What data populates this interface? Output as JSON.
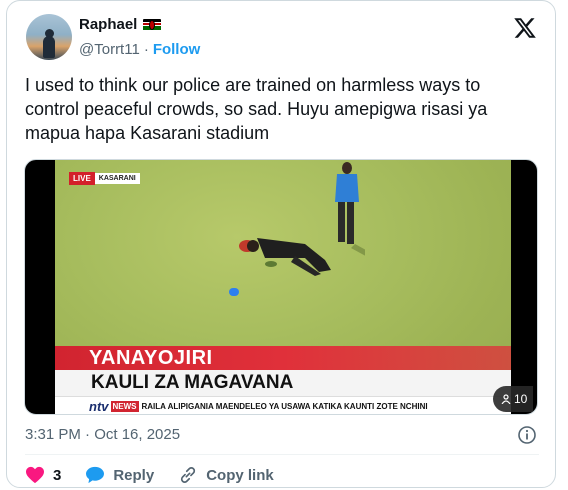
{
  "author": {
    "display_name": "Raphael",
    "flag_icon": "kenya-flag-icon",
    "handle": "@Torrt11",
    "separator": "·",
    "follow_label": "Follow"
  },
  "brand_icon": "x-logo-icon",
  "tweet": {
    "text": "I used to think our police are trained on harmless ways to control peaceful crowds, so sad. Huyu amepigwa risasi ya mapua hapa Kasarani stadium"
  },
  "media": {
    "live_label": "LIVE",
    "location_label": "KASARANI",
    "headline_red": "YANAYOJIRI",
    "headline_white": "KAULI ZA MAGAVANA",
    "channel_logo": "ntv",
    "news_tag": "NEWS",
    "ticker_text": "RAILA ALIPIGANIA MAENDELEO YA USAWA KATIKA KAUNTI ZOTE NCHINI",
    "viewer_count": "10"
  },
  "meta": {
    "timestamp": "3:31 PM · Oct 16, 2025"
  },
  "actions": {
    "like_count": "3",
    "reply_label": "Reply",
    "copy_link_label": "Copy link"
  },
  "colors": {
    "accent": "#1d9bf0",
    "like": "#f91880",
    "text_secondary": "#536471"
  }
}
